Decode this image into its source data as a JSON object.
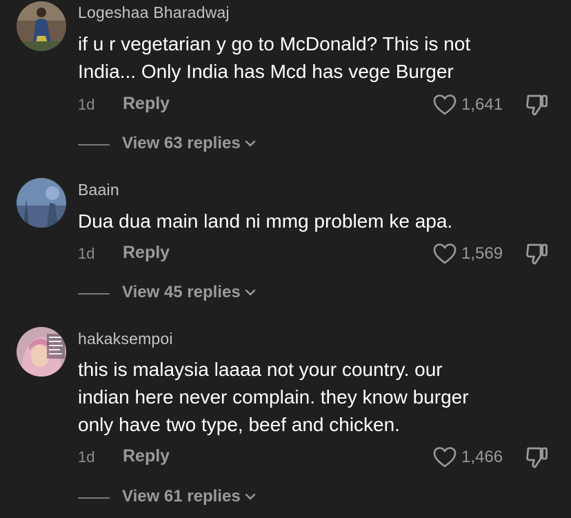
{
  "comments": [
    {
      "username": "Logeshaa Bharadwaj",
      "lines": [
        "if u r vegetarian y go to McDonald? This is not",
        "India... Only India has Mcd has vege Burger"
      ],
      "time": "1d",
      "reply_label": "Reply",
      "likes": "1,641",
      "view_replies": "View 63 replies"
    },
    {
      "username": "Baain",
      "lines": [
        "Dua dua main land ni mmg problem ke apa."
      ],
      "time": "1d",
      "reply_label": "Reply",
      "likes": "1,569",
      "view_replies": "View 45 replies"
    },
    {
      "username": "hakaksempoi",
      "lines": [
        "this is malaysia laaaa not your country. our",
        "indian here never complain. they know burger",
        "only have two type, beef and chicken."
      ],
      "time": "1d",
      "reply_label": "Reply",
      "likes": "1,466",
      "view_replies": "View 61 replies"
    }
  ],
  "icons": {
    "like": "heart-outline-icon",
    "dislike": "thumbs-down-icon",
    "expand": "chevron-down-icon"
  },
  "colors": {
    "background": "#1f1f1f",
    "text": "#ffffff",
    "muted": "#9a9a9a"
  }
}
